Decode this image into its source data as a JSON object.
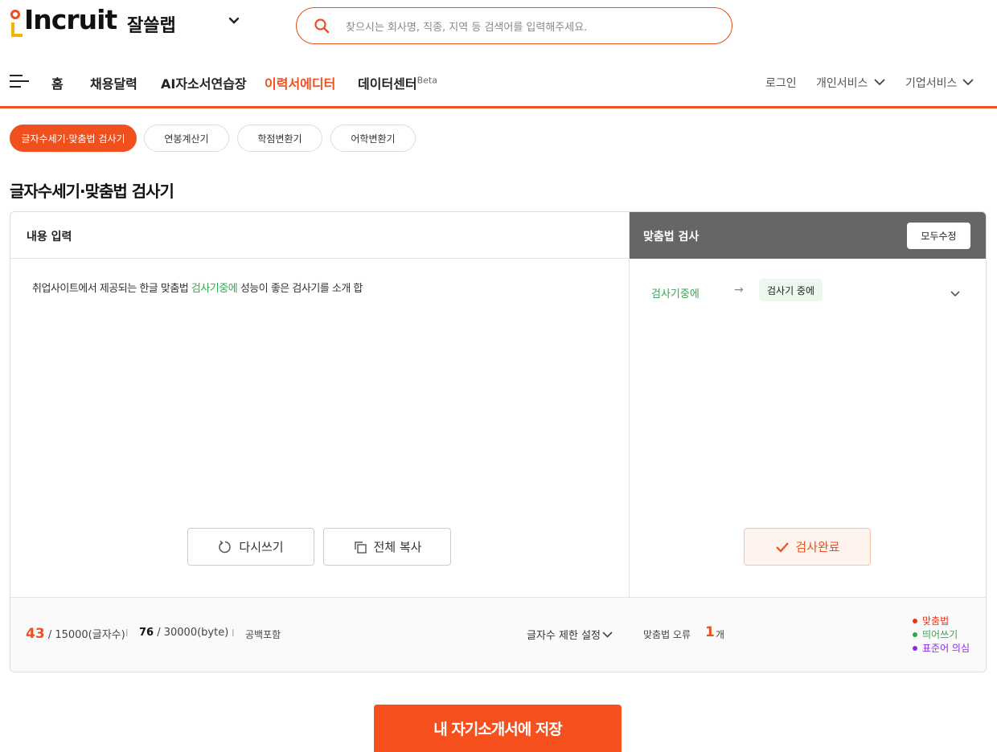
{
  "header": {
    "logo_text": "Incruit",
    "service_name": "잘쓸랩",
    "search_placeholder": "찾으시는 회사명, 직종, 지역 등 검색어를 입력해주세요."
  },
  "nav": {
    "items": [
      {
        "label": "홈"
      },
      {
        "label": "채용달력"
      },
      {
        "label": "AI자소서연습장"
      },
      {
        "label": "이력서에디터",
        "active": true
      },
      {
        "label": "데이터센터",
        "badge": "Beta"
      }
    ],
    "login": "로그인",
    "personal": "개인서비스",
    "corporate": "기업서비스"
  },
  "tools": {
    "pills": [
      "글자수세기·맞춤법 검사기",
      "연봉계산기",
      "학점변환기",
      "어학변환기"
    ],
    "active_index": 0
  },
  "page_title": "글자수세기·맞춤법 검사기",
  "editor": {
    "header": "내용 입력",
    "text_before": "취업사이트에서 제공되는 한글 맞춤법 ",
    "text_error": "검사기중에",
    "text_after": " 성능이 좋은 검사기를 소개 합",
    "rewrite_label": "다시쓰기",
    "copy_label": "전체 복사"
  },
  "spellcheck": {
    "header": "맞춤법 검사",
    "fix_all_label": "모두수정",
    "corrections": [
      {
        "original": "검사기중에",
        "suggestion": "검사기 중에"
      }
    ],
    "done_label": "검사완료"
  },
  "counts": {
    "chars": "43",
    "chars_limit": "/ 15000(글자수)",
    "bytes": "76",
    "bytes_limit": "/ 30000(byte)",
    "separator": "I",
    "space_note": "공백포함",
    "limit_setting": "글자수 제한 설정"
  },
  "errors": {
    "label": "맞춤법 오류",
    "count": "1",
    "unit": "개",
    "legend": [
      {
        "label": "맞춤법",
        "color": "#e8341c"
      },
      {
        "label": "띄어쓰기",
        "color": "#2fa84f"
      },
      {
        "label": "표준어 의심",
        "color": "#8a2be2"
      }
    ]
  },
  "save_label": "내 자기소개서에 저장",
  "colors": {
    "accent": "#f0501e",
    "correct": "#2fa84f"
  }
}
